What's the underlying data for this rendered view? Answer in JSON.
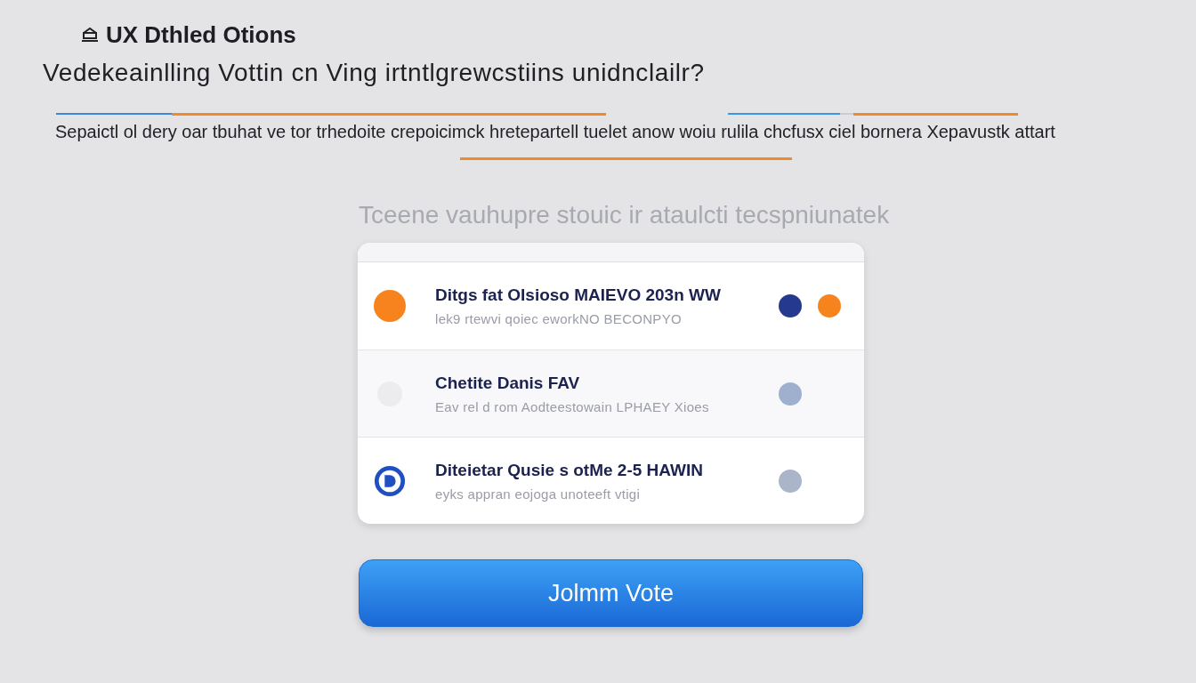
{
  "header": {
    "title": "UX Dthled Otions"
  },
  "heading": "Vedekeainlling Vottin cn Ving irtntlgrewcstiins unidnclailr?",
  "description": "Sepaictl ol dery oar tbuhat ve tor trhedoite crepoicimck hretepartell tuelet anow woiu rulila chcfusx ciel bornera Xepavustk attart",
  "hint": "Tceene vauhupre stouic ir ataulcti tecspniunatek",
  "options": [
    {
      "title": "Ditgs fat OIsioso MAIEVO 203n WW",
      "subtitle": "lek9 rtewvi qoiec eworkNO BECONPYO",
      "marker": {
        "kind": "dot",
        "color": "#f7831f"
      },
      "indicators": [
        {
          "color": "#253a8e"
        },
        {
          "color": "#f7831f"
        }
      ]
    },
    {
      "title": "Chetite Danis FAV",
      "subtitle": "Eav rel d rom Aodteestowain LPHAEY Xioes",
      "marker": {
        "kind": "faint",
        "color": "#ececef"
      },
      "indicators": [
        {
          "color": "#9fb0cf"
        }
      ]
    },
    {
      "title": "Diteietar Qusie s otMe 2-5 HAWIN",
      "subtitle": "eyks appran eojoga unoteeft vtigi",
      "marker": {
        "kind": "ring",
        "color": "#1f4fc0"
      },
      "indicators": [
        {
          "color": "#aab5ca"
        }
      ]
    }
  ],
  "submit_button": "Jolmm Vote"
}
